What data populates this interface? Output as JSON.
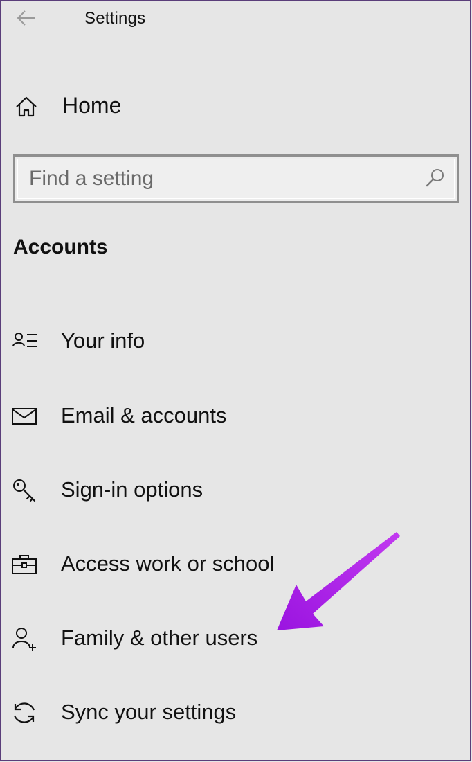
{
  "window": {
    "title": "Settings"
  },
  "nav": {
    "home_label": "Home"
  },
  "search": {
    "placeholder": "Find a setting",
    "value": ""
  },
  "section": {
    "heading": "Accounts"
  },
  "menu": {
    "items": [
      {
        "label": "Your info",
        "icon": "person-list-icon"
      },
      {
        "label": "Email & accounts",
        "icon": "mail-icon"
      },
      {
        "label": "Sign-in options",
        "icon": "key-icon"
      },
      {
        "label": "Access work or school",
        "icon": "briefcase-icon"
      },
      {
        "label": "Family & other users",
        "icon": "person-add-icon"
      },
      {
        "label": "Sync your settings",
        "icon": "sync-icon"
      }
    ]
  },
  "annotation": {
    "arrow_color": "#a41ee6",
    "icon": "arrow-pointer-icon"
  },
  "colors": {
    "background": "#e6e6e6",
    "text": "#111111",
    "frame_border": "#5a3e7a"
  }
}
